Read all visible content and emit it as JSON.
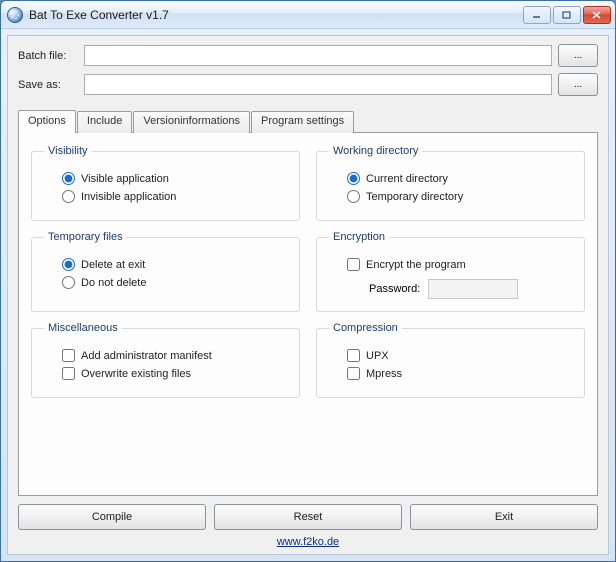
{
  "window": {
    "title": "Bat To Exe Converter v1.7"
  },
  "files": {
    "batch_label": "Batch file:",
    "batch_value": "",
    "saveas_label": "Save as:",
    "saveas_value": "",
    "browse_label": "..."
  },
  "tabs": [
    "Options",
    "Include",
    "Versioninformations",
    "Program settings"
  ],
  "active_tab": "Options",
  "groups": {
    "visibility": {
      "legend": "Visibility",
      "options": [
        "Visible application",
        "Invisible application"
      ],
      "selected": 0
    },
    "working_dir": {
      "legend": "Working directory",
      "options": [
        "Current directory",
        "Temporary directory"
      ],
      "selected": 0
    },
    "temp_files": {
      "legend": "Temporary files",
      "options": [
        "Delete at exit",
        "Do not delete"
      ],
      "selected": 0
    },
    "encryption": {
      "legend": "Encryption",
      "encrypt_label": "Encrypt the program",
      "encrypt_checked": false,
      "password_label": "Password:",
      "password_value": ""
    },
    "misc": {
      "legend": "Miscellaneous",
      "admin_label": "Add administrator manifest",
      "admin_checked": false,
      "overwrite_label": "Overwrite existing files",
      "overwrite_checked": false
    },
    "compression": {
      "legend": "Compression",
      "upx_label": "UPX",
      "upx_checked": false,
      "mpress_label": "Mpress",
      "mpress_checked": false
    }
  },
  "buttons": {
    "compile": "Compile",
    "reset": "Reset",
    "exit": "Exit"
  },
  "footer": {
    "link_text": "www.f2ko.de"
  }
}
